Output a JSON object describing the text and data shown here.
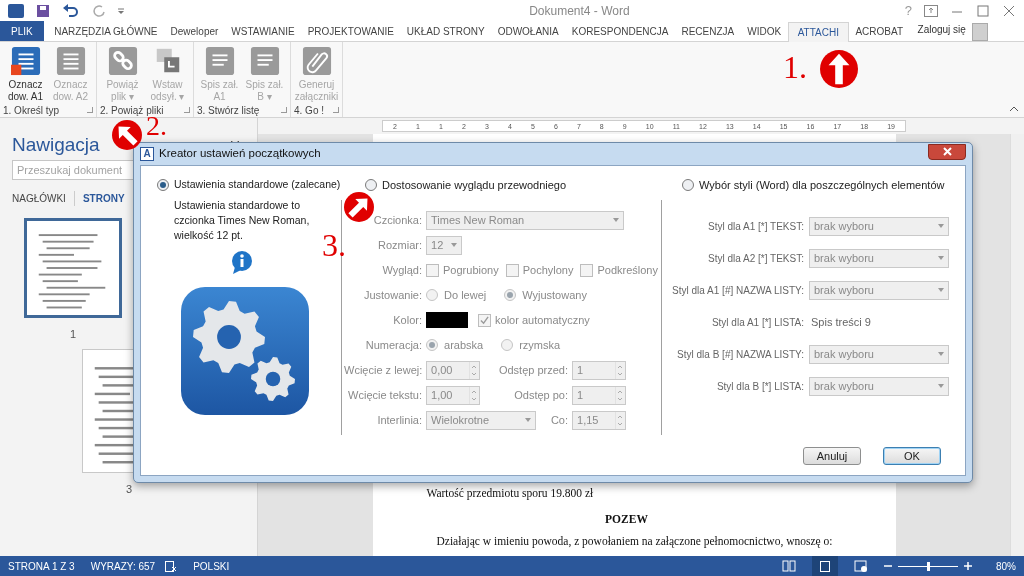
{
  "window": {
    "title": "Dokument4 - Word",
    "help": "?"
  },
  "tabs": [
    {
      "label": "PLIK",
      "kind": "file",
      "selected": false
    },
    {
      "label": "NARZĘDZIA GŁÓWNE",
      "kind": "tab",
      "selected": false
    },
    {
      "label": "Deweloper",
      "kind": "tab",
      "selected": false
    },
    {
      "label": "WSTAWIANIE",
      "kind": "tab",
      "selected": false
    },
    {
      "label": "PROJEKTOWANIE",
      "kind": "tab",
      "selected": false
    },
    {
      "label": "UKŁAD STRONY",
      "kind": "tab",
      "selected": false
    },
    {
      "label": "ODWOŁANIA",
      "kind": "tab",
      "selected": false
    },
    {
      "label": "KORESPONDENCJA",
      "kind": "tab",
      "selected": false
    },
    {
      "label": "RECENZJA",
      "kind": "tab",
      "selected": false
    },
    {
      "label": "WIDOK",
      "kind": "tab",
      "selected": false
    },
    {
      "label": "ATTACHI",
      "kind": "tab",
      "selected": true
    },
    {
      "label": "ACROBAT",
      "kind": "tab",
      "selected": false
    }
  ],
  "account": {
    "label": "Zaloguj się"
  },
  "ribbon_groups": [
    {
      "label": "1. Określ typ",
      "buttons": [
        {
          "label": "Oznacz dow. A1",
          "disabled": false
        },
        {
          "label": "Oznacz dow. A2",
          "disabled": true
        }
      ]
    },
    {
      "label": "2. Powiąż pliki",
      "buttons": [
        {
          "label": "Powiąż plik ▾",
          "disabled": true
        },
        {
          "label": "Wstaw odsył. ▾",
          "disabled": true
        }
      ]
    },
    {
      "label": "3. Stwórz listę",
      "buttons": [
        {
          "label": "Spis zał. A1",
          "disabled": true
        },
        {
          "label": "Spis zał. B ▾",
          "disabled": true
        }
      ]
    },
    {
      "label": "4. Go !",
      "buttons": [
        {
          "label": "Generuj załączniki",
          "disabled": true
        }
      ]
    }
  ],
  "navigation": {
    "title": "Nawigacja",
    "search": {
      "placeholder": "Przeszukaj dokument"
    },
    "tabs": [
      {
        "label": "NAGŁÓWKI",
        "selected": false
      },
      {
        "label": "STRONY",
        "selected": true
      }
    ],
    "pages": [
      {
        "label": "1",
        "selected": true
      },
      {
        "label": "3",
        "selected": false
      }
    ]
  },
  "ruler": {
    "labels": [
      "2",
      "1",
      "1",
      "2",
      "3",
      "4",
      "5",
      "6",
      "7",
      "8",
      "9",
      "10",
      "11",
      "12",
      "13",
      "14",
      "15",
      "16",
      "17",
      "18",
      "19"
    ]
  },
  "document": {
    "paragraphs": [
      {
        "kind": "plain",
        "text": "Wartość przedmiotu sporu 19.800 zł"
      },
      {
        "kind": "heading",
        "text": "POZEW"
      },
      {
        "kind": "indented",
        "text": "Działając w imieniu powoda, z powołaniem na załączone pełnomocnictwo, wnoszę o:"
      }
    ]
  },
  "status_bar": {
    "items": [
      "STRONA 1 Z 3",
      "WYRAZY: 657",
      "POLSKI"
    ],
    "zoom": {
      "level": 0.5,
      "label": "80%"
    }
  },
  "annotations": [
    {
      "label": "1."
    },
    {
      "label": "2."
    },
    {
      "label": "3."
    }
  ],
  "dialog": {
    "icon": "A",
    "title": "Kreator ustawień początkowych",
    "modes": [
      {
        "label": "Ustawienia standardowe (zalecane)",
        "selected": true
      },
      {
        "label": "Dostosowanie wyglądu przewodniego",
        "selected": false
      },
      {
        "label": "Wybór styli (Word) dla poszczególnych elementów",
        "selected": false
      }
    ],
    "standard": {
      "description": "Ustawienia standardowe to czcionka Times New Roman, wielkość 12 pt."
    },
    "custom": {
      "disabled": true,
      "rows": [
        {
          "kind": "select",
          "label": "Czcionka:",
          "value": "Times New Roman"
        },
        {
          "kind": "size",
          "label": "Rozmiar:",
          "value": "12"
        },
        {
          "kind": "checks",
          "label": "Wygląd:",
          "options": [
            {
              "label": "Pogrubiony",
              "checked": false
            },
            {
              "label": "Pochylony",
              "checked": false
            },
            {
              "label": "Podkreślony",
              "checked": false
            }
          ]
        },
        {
          "kind": "radios",
          "label": "Justowanie:",
          "options": [
            {
              "label": "Do lewej",
              "selected": false
            },
            {
              "label": "Wyjustowany",
              "selected": true
            }
          ]
        },
        {
          "kind": "color",
          "label": "Kolor:",
          "color": "#000000",
          "auto": {
            "label": "kolor automatyczny",
            "checked": true
          }
        },
        {
          "kind": "radios",
          "label": "Numeracja:",
          "options": [
            {
              "label": "arabska",
              "selected": true
            },
            {
              "label": "rzymska",
              "selected": false
            }
          ]
        },
        {
          "kind": "spins",
          "fields": [
            {
              "label": "Wcięcie z lewej:",
              "value": "0,00"
            },
            {
              "label": "Odstęp przed:",
              "value": "1"
            }
          ]
        },
        {
          "kind": "spins",
          "fields": [
            {
              "label": "Wcięcie tekstu:",
              "value": "1,00"
            },
            {
              "label": "Odstęp po:",
              "value": "1"
            }
          ]
        },
        {
          "kind": "spacing",
          "label": "Interlinia:",
          "value": "Wielokrotne",
          "extra": {
            "label": "Co:",
            "value": "1,15"
          }
        }
      ]
    },
    "styles": [
      {
        "kind": "select",
        "label": "Styl dla A1 [*] TEKST:",
        "value": "brak wyboru"
      },
      {
        "kind": "select",
        "label": "Styl dla A2 [*] TEKST:",
        "value": "brak wyboru"
      },
      {
        "kind": "select",
        "label": "Styl dla A1 [#] NAZWA LISTY:",
        "value": "brak wyboru"
      },
      {
        "kind": "text",
        "label": "Styl dla A1 [*] LISTA:",
        "value": "Spis treści 9"
      },
      {
        "kind": "select",
        "label": "Styl dla B [#] NAZWA LISTY:",
        "value": "brak wyboru"
      },
      {
        "kind": "select",
        "label": "Styl dla B [*] LISTA:",
        "value": "brak wyboru"
      }
    ],
    "buttons": [
      {
        "label": "Anuluj",
        "default": false
      },
      {
        "label": "OK",
        "default": true
      }
    ]
  }
}
